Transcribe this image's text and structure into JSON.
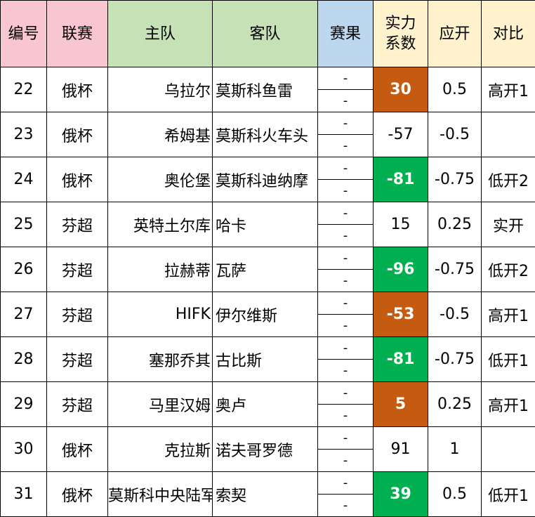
{
  "headers": {
    "id": "编号",
    "league": "联赛",
    "home": "主队",
    "away": "客队",
    "result": "赛果",
    "strength_line1": "实力",
    "strength_line2": "系数",
    "handicap": "应开",
    "compare": "对比"
  },
  "colors": {
    "header_pink": "#f7c6d1",
    "header_green": "#c6e1b5",
    "header_blue": "#bdd7ee",
    "header_yellow": "#fff2cc",
    "highlight_orange": "#c55a11",
    "highlight_green": "#00b050"
  },
  "rows": [
    {
      "id": "22",
      "league": "俄杯",
      "home": "乌拉尔",
      "away": "莫斯科鱼雷",
      "result_top": "-",
      "result_bottom": "-",
      "strength": "30",
      "strength_highlight": "orange",
      "handicap": "0.5",
      "compare": "高开1"
    },
    {
      "id": "23",
      "league": "俄杯",
      "home": "希姆基",
      "away": "莫斯科火车头",
      "result_top": "-",
      "result_bottom": "-",
      "strength": "-57",
      "strength_highlight": "none",
      "handicap": "-0.5",
      "compare": ""
    },
    {
      "id": "24",
      "league": "俄杯",
      "home": "奥伦堡",
      "away": "莫斯科迪纳摩",
      "result_top": "-",
      "result_bottom": "-",
      "strength": "-81",
      "strength_highlight": "green",
      "handicap": "-0.75",
      "compare": "低开2"
    },
    {
      "id": "25",
      "league": "芬超",
      "home": "英特土尔库",
      "away": "哈卡",
      "result_top": "-",
      "result_bottom": "-",
      "strength": "15",
      "strength_highlight": "none",
      "handicap": "0.25",
      "compare": "实开"
    },
    {
      "id": "26",
      "league": "芬超",
      "home": "拉赫蒂",
      "away": "瓦萨",
      "result_top": "-",
      "result_bottom": "-",
      "strength": "-96",
      "strength_highlight": "green",
      "handicap": "-0.75",
      "compare": "低开2"
    },
    {
      "id": "27",
      "league": "芬超",
      "home": "HIFK",
      "away": "伊尔维斯",
      "result_top": "-",
      "result_bottom": "-",
      "strength": "-53",
      "strength_highlight": "orange",
      "handicap": "-0.5",
      "compare": "高开1"
    },
    {
      "id": "28",
      "league": "芬超",
      "home": "塞那乔其",
      "away": "古比斯",
      "result_top": "-",
      "result_bottom": "-",
      "strength": "-81",
      "strength_highlight": "green",
      "handicap": "-0.75",
      "compare": "低开1"
    },
    {
      "id": "29",
      "league": "芬超",
      "home": "马里汉姆",
      "away": "奥卢",
      "result_top": "-",
      "result_bottom": "-",
      "strength": "5",
      "strength_highlight": "orange",
      "handicap": "0.25",
      "compare": "高开1"
    },
    {
      "id": "30",
      "league": "俄杯",
      "home": "克拉斯",
      "away": "诺夫哥罗德",
      "result_top": "-",
      "result_bottom": "-",
      "strength": "91",
      "strength_highlight": "none",
      "handicap": "1",
      "compare": ""
    },
    {
      "id": "31",
      "league": "俄杯",
      "home": "莫斯科中央陆军",
      "away": "索契",
      "result_top": "-",
      "result_bottom": "-",
      "strength": "39",
      "strength_highlight": "green",
      "handicap": "0.5",
      "compare": "低开1"
    }
  ]
}
